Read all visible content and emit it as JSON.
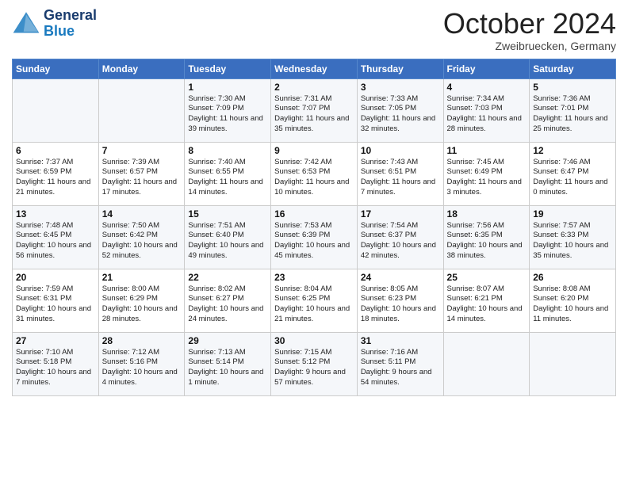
{
  "header": {
    "logo_line1": "General",
    "logo_line2": "Blue",
    "month_title": "October 2024",
    "subtitle": "Zweibruecken, Germany"
  },
  "days_of_week": [
    "Sunday",
    "Monday",
    "Tuesday",
    "Wednesday",
    "Thursday",
    "Friday",
    "Saturday"
  ],
  "weeks": [
    [
      {
        "day": "",
        "info": ""
      },
      {
        "day": "",
        "info": ""
      },
      {
        "day": "1",
        "info": "Sunrise: 7:30 AM\nSunset: 7:09 PM\nDaylight: 11 hours\nand 39 minutes."
      },
      {
        "day": "2",
        "info": "Sunrise: 7:31 AM\nSunset: 7:07 PM\nDaylight: 11 hours\nand 35 minutes."
      },
      {
        "day": "3",
        "info": "Sunrise: 7:33 AM\nSunset: 7:05 PM\nDaylight: 11 hours\nand 32 minutes."
      },
      {
        "day": "4",
        "info": "Sunrise: 7:34 AM\nSunset: 7:03 PM\nDaylight: 11 hours\nand 28 minutes."
      },
      {
        "day": "5",
        "info": "Sunrise: 7:36 AM\nSunset: 7:01 PM\nDaylight: 11 hours\nand 25 minutes."
      }
    ],
    [
      {
        "day": "6",
        "info": "Sunrise: 7:37 AM\nSunset: 6:59 PM\nDaylight: 11 hours\nand 21 minutes."
      },
      {
        "day": "7",
        "info": "Sunrise: 7:39 AM\nSunset: 6:57 PM\nDaylight: 11 hours\nand 17 minutes."
      },
      {
        "day": "8",
        "info": "Sunrise: 7:40 AM\nSunset: 6:55 PM\nDaylight: 11 hours\nand 14 minutes."
      },
      {
        "day": "9",
        "info": "Sunrise: 7:42 AM\nSunset: 6:53 PM\nDaylight: 11 hours\nand 10 minutes."
      },
      {
        "day": "10",
        "info": "Sunrise: 7:43 AM\nSunset: 6:51 PM\nDaylight: 11 hours\nand 7 minutes."
      },
      {
        "day": "11",
        "info": "Sunrise: 7:45 AM\nSunset: 6:49 PM\nDaylight: 11 hours\nand 3 minutes."
      },
      {
        "day": "12",
        "info": "Sunrise: 7:46 AM\nSunset: 6:47 PM\nDaylight: 11 hours\nand 0 minutes."
      }
    ],
    [
      {
        "day": "13",
        "info": "Sunrise: 7:48 AM\nSunset: 6:45 PM\nDaylight: 10 hours\nand 56 minutes."
      },
      {
        "day": "14",
        "info": "Sunrise: 7:50 AM\nSunset: 6:42 PM\nDaylight: 10 hours\nand 52 minutes."
      },
      {
        "day": "15",
        "info": "Sunrise: 7:51 AM\nSunset: 6:40 PM\nDaylight: 10 hours\nand 49 minutes."
      },
      {
        "day": "16",
        "info": "Sunrise: 7:53 AM\nSunset: 6:39 PM\nDaylight: 10 hours\nand 45 minutes."
      },
      {
        "day": "17",
        "info": "Sunrise: 7:54 AM\nSunset: 6:37 PM\nDaylight: 10 hours\nand 42 minutes."
      },
      {
        "day": "18",
        "info": "Sunrise: 7:56 AM\nSunset: 6:35 PM\nDaylight: 10 hours\nand 38 minutes."
      },
      {
        "day": "19",
        "info": "Sunrise: 7:57 AM\nSunset: 6:33 PM\nDaylight: 10 hours\nand 35 minutes."
      }
    ],
    [
      {
        "day": "20",
        "info": "Sunrise: 7:59 AM\nSunset: 6:31 PM\nDaylight: 10 hours\nand 31 minutes."
      },
      {
        "day": "21",
        "info": "Sunrise: 8:00 AM\nSunset: 6:29 PM\nDaylight: 10 hours\nand 28 minutes."
      },
      {
        "day": "22",
        "info": "Sunrise: 8:02 AM\nSunset: 6:27 PM\nDaylight: 10 hours\nand 24 minutes."
      },
      {
        "day": "23",
        "info": "Sunrise: 8:04 AM\nSunset: 6:25 PM\nDaylight: 10 hours\nand 21 minutes."
      },
      {
        "day": "24",
        "info": "Sunrise: 8:05 AM\nSunset: 6:23 PM\nDaylight: 10 hours\nand 18 minutes."
      },
      {
        "day": "25",
        "info": "Sunrise: 8:07 AM\nSunset: 6:21 PM\nDaylight: 10 hours\nand 14 minutes."
      },
      {
        "day": "26",
        "info": "Sunrise: 8:08 AM\nSunset: 6:20 PM\nDaylight: 10 hours\nand 11 minutes."
      }
    ],
    [
      {
        "day": "27",
        "info": "Sunrise: 7:10 AM\nSunset: 5:18 PM\nDaylight: 10 hours\nand 7 minutes."
      },
      {
        "day": "28",
        "info": "Sunrise: 7:12 AM\nSunset: 5:16 PM\nDaylight: 10 hours\nand 4 minutes."
      },
      {
        "day": "29",
        "info": "Sunrise: 7:13 AM\nSunset: 5:14 PM\nDaylight: 10 hours\nand 1 minute."
      },
      {
        "day": "30",
        "info": "Sunrise: 7:15 AM\nSunset: 5:12 PM\nDaylight: 9 hours\nand 57 minutes."
      },
      {
        "day": "31",
        "info": "Sunrise: 7:16 AM\nSunset: 5:11 PM\nDaylight: 9 hours\nand 54 minutes."
      },
      {
        "day": "",
        "info": ""
      },
      {
        "day": "",
        "info": ""
      }
    ]
  ]
}
